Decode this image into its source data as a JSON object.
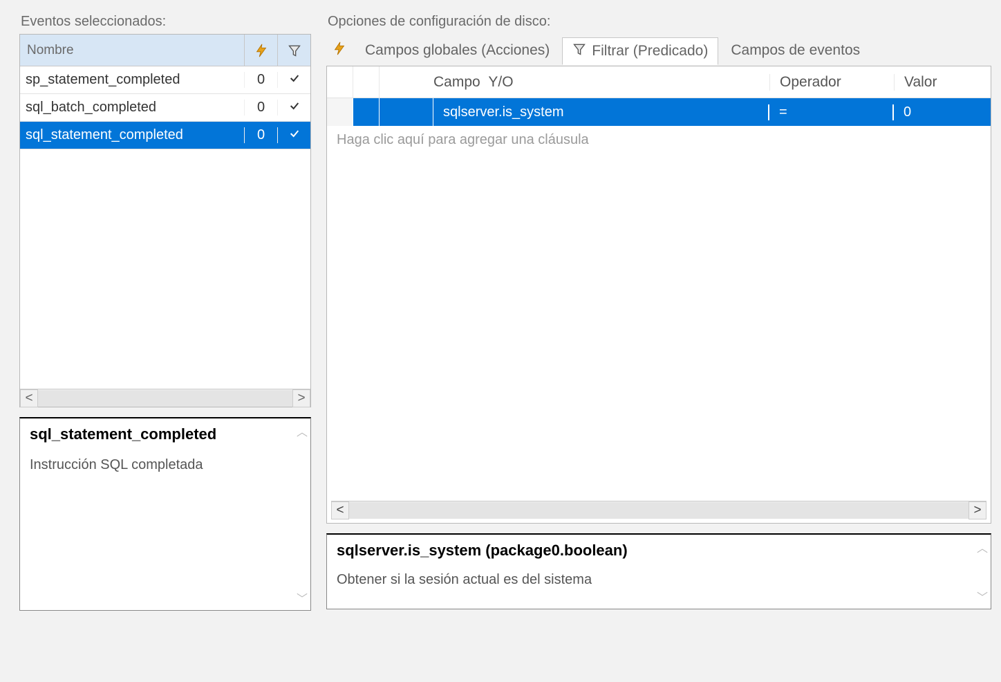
{
  "left": {
    "section_label": "Eventos seleccionados:",
    "header_name": "Nombre",
    "events": [
      {
        "name": "sp_statement_completed",
        "count": "0",
        "filtered": true
      },
      {
        "name": "sql_batch_completed",
        "count": "0",
        "filtered": true
      },
      {
        "name": "sql_statement_completed",
        "count": "0",
        "filtered": true
      }
    ],
    "selected_index": 2,
    "desc_title": "sql_statement_completed",
    "desc_body": "Instrucción SQL completada"
  },
  "right": {
    "section_label": "Opciones de configuración de disco:",
    "tabs": {
      "globals": "Campos globales (Acciones)",
      "filter": "Filtrar (Predicado)",
      "fields": "Campos de eventos"
    },
    "active_tab": "filter",
    "filter_header": {
      "field": "Campo",
      "yo": "Y/O",
      "operator": "Operador",
      "value": "Valor"
    },
    "filter_rows": [
      {
        "field": "sqlserver.is_system",
        "operator": "=",
        "value": "0"
      }
    ],
    "filter_add_hint": "Haga clic aquí para agregar una cláusula",
    "filter_desc_title": "sqlserver.is_system (package0.boolean)",
    "filter_desc_body": "Obtener si la sesión actual es del sistema"
  }
}
